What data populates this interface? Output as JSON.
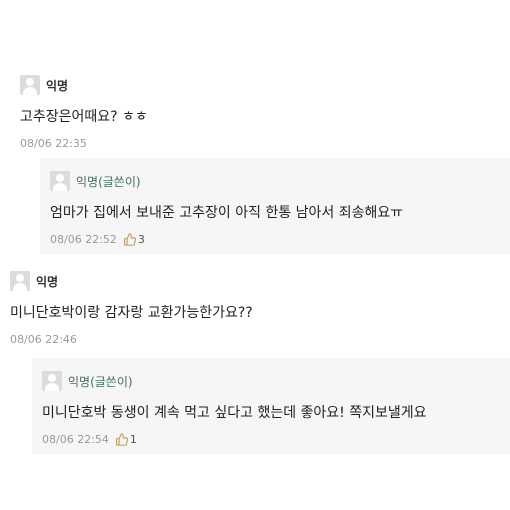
{
  "comments": [
    {
      "author": "익명",
      "text": "고추장은어때요? ㅎㅎ",
      "timestamp": "08/06 22:35"
    },
    {
      "author": "익명(글쓴이)",
      "text": "엄마가 집에서 보내준 고추장이 아직 한통 남아서 죄송해요ㅠ",
      "timestamp": "08/06 22:52",
      "likes": "3"
    },
    {
      "author": "익명",
      "text": "미니단호박이랑 감자랑 교환가능한가요??",
      "timestamp": "08/06 22:46"
    },
    {
      "author": "익명(글쓴이)",
      "text": "미니단호박 동생이 계속 먹고 싶다고 했는데 좋아요! 쪽지보낼게요",
      "timestamp": "08/06 22:54",
      "likes": "1"
    }
  ],
  "icons": {
    "avatar": "default-user-avatar",
    "like": "thumbs-up-icon"
  }
}
